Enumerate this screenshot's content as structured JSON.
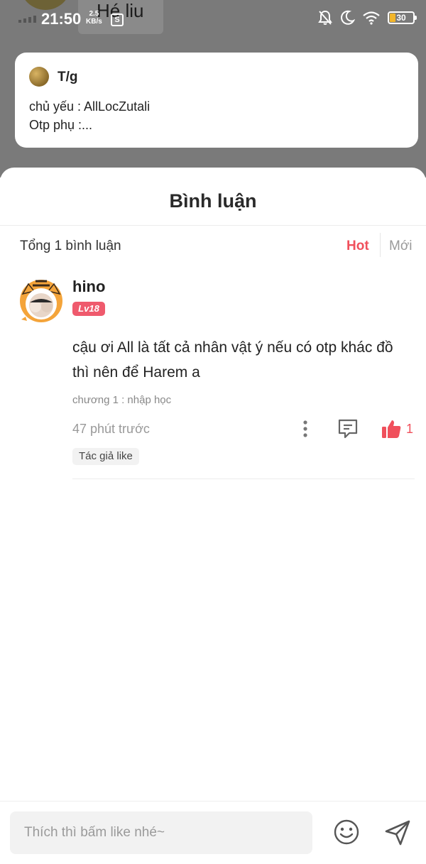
{
  "status_bar": {
    "time": "21:50",
    "net_speed_value": "2.5",
    "net_speed_unit": "KB/s",
    "app_icon_letter": "S",
    "battery": "30"
  },
  "background_page": {
    "title": "Hé liu"
  },
  "post": {
    "author": "T/g",
    "line1": "chủ yếu : AllLocZutali",
    "line2": "Otp phụ :..."
  },
  "comments_sheet": {
    "title": "Bình luận",
    "total": "Tổng 1 bình luận",
    "sort_hot": "Hot",
    "sort_new": "Mới"
  },
  "comment": {
    "username": "hino",
    "level": "Lv18",
    "text": "cậu ơi All là tất cả nhân vật ý nếu có otp khác đồ thì nên để Harem a",
    "chapter": "chương 1 : nhập học",
    "time": "47 phút trước",
    "like_count": "1",
    "author_like_tag": "Tác giả like"
  },
  "input": {
    "placeholder": "Thích thì bấm like nhé~"
  },
  "colors": {
    "accent": "#f0505c",
    "backdrop": "#7a7a7a"
  }
}
